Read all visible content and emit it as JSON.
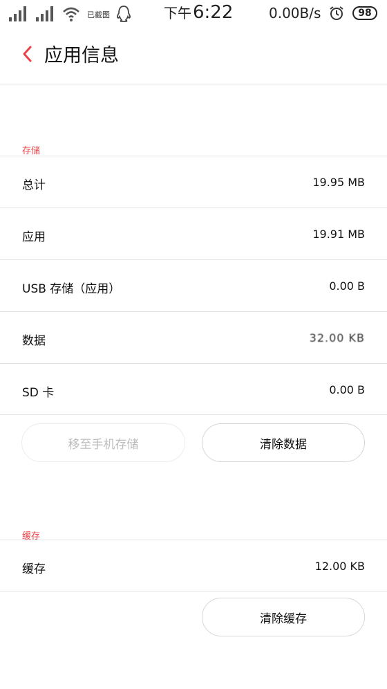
{
  "status_bar": {
    "network_label": "已截图",
    "time_prefix": "下午",
    "time": "6:22",
    "net_speed": "0.00B/s",
    "battery": "98"
  },
  "header": {
    "title": "应用信息"
  },
  "storage": {
    "section_label": "存储",
    "rows": [
      {
        "label": "总计",
        "value": "19.95 MB"
      },
      {
        "label": "应用",
        "value": "19.91 MB"
      },
      {
        "label": "USB 存储（应用）",
        "value": "0.00 B"
      },
      {
        "label": "数据",
        "value": "32.00 KB"
      },
      {
        "label": "SD 卡",
        "value": "0.00 B"
      }
    ],
    "move_button": "移至手机存储",
    "clear_data_button": "清除数据"
  },
  "cache": {
    "section_label": "缓存",
    "rows": [
      {
        "label": "缓存",
        "value": "12.00 KB"
      }
    ],
    "clear_cache_button": "清除缓存"
  },
  "colors": {
    "accent": "#e8424a",
    "divider": "#e2e2e2",
    "disabled_text": "#bdbdbd"
  },
  "icons": {
    "back": "chevron-left-icon",
    "signal": "signal-icon",
    "wifi": "wifi-icon",
    "qq": "qq-icon",
    "alarm": "alarm-icon",
    "battery": "battery-icon"
  }
}
